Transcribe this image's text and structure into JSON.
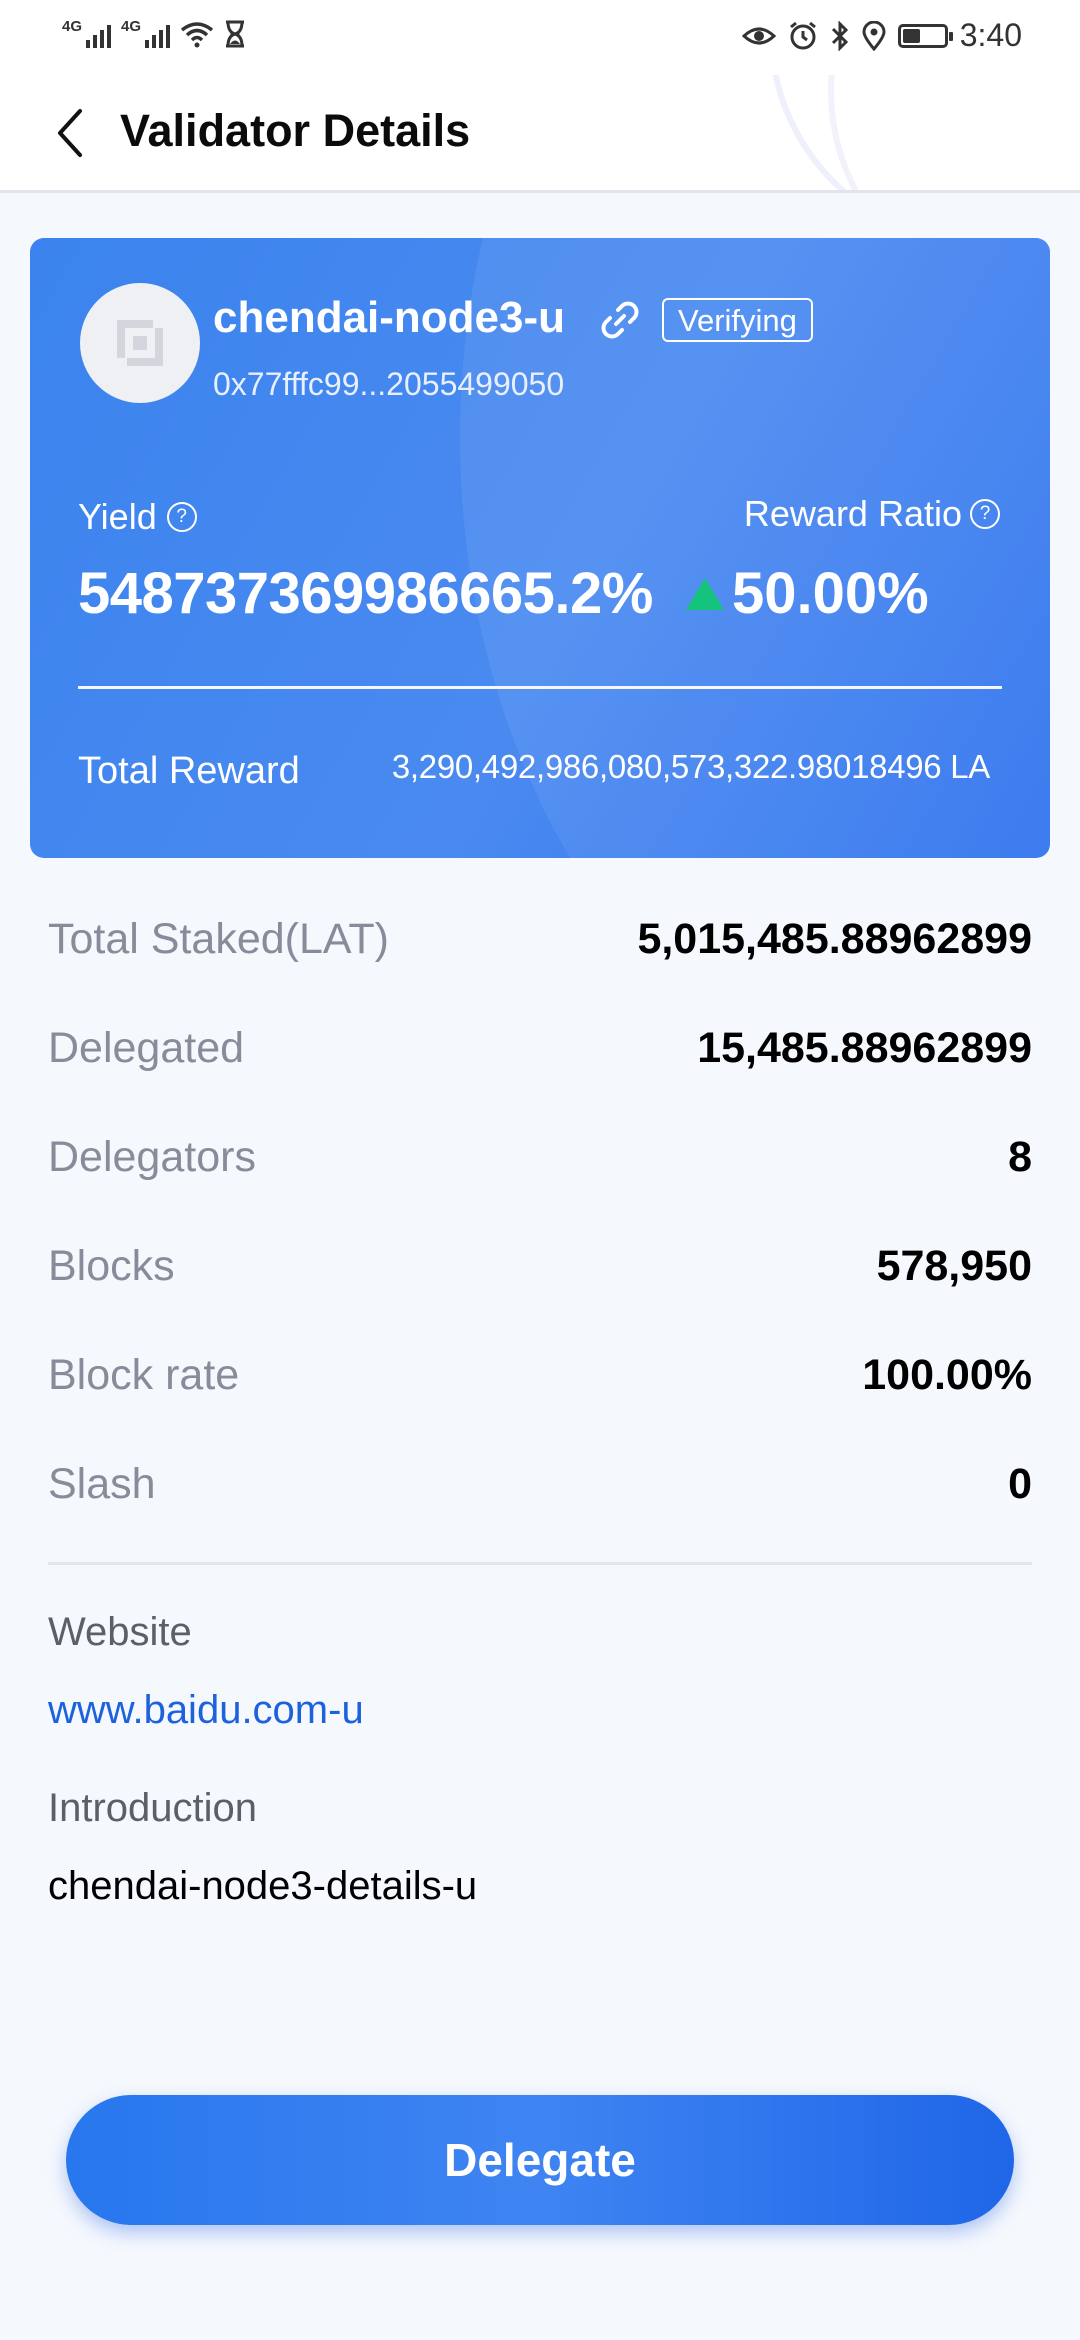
{
  "status_bar": {
    "network_1": "4G",
    "network_2": "4G",
    "time": "3:40",
    "icons": [
      "signal-icon",
      "signal-icon",
      "wifi-icon",
      "hourglass-icon",
      "eye-icon",
      "alarm-icon",
      "bluetooth-icon",
      "location-icon",
      "battery-icon"
    ]
  },
  "header": {
    "title": "Validator Details",
    "back_icon": "back-arrow-icon"
  },
  "validator": {
    "name": "chendai-node3-u",
    "status_badge": "Verifying",
    "address": "0x77fffc99...2055499050",
    "yield_label": "Yield",
    "yield_value": "548737369986665.2%",
    "yield_trend": "up",
    "reward_ratio_label": "Reward Ratio",
    "reward_ratio_value": "50.00%",
    "total_reward_label": "Total Reward",
    "total_reward_value": "3,290,492,986,080,573,322.98018496 LA"
  },
  "stats": [
    {
      "label": "Total Staked(LAT)",
      "value": "5,015,485.88962899"
    },
    {
      "label": "Delegated",
      "value": "15,485.88962899"
    },
    {
      "label": "Delegators",
      "value": "8"
    },
    {
      "label": "Blocks",
      "value": "578,950"
    },
    {
      "label": "Block rate",
      "value": "100.00%"
    },
    {
      "label": "Slash",
      "value": "0"
    }
  ],
  "info": {
    "website_label": "Website",
    "website_value": "www.baidu.com-u",
    "introduction_label": "Introduction",
    "introduction_value": "chendai-node3-details-u"
  },
  "actions": {
    "delegate_label": "Delegate"
  },
  "colors": {
    "card_primary": "#3b83ee",
    "accent_blue": "#1d62dd",
    "trend_up": "#14c37c",
    "label_gray": "#868c99"
  }
}
